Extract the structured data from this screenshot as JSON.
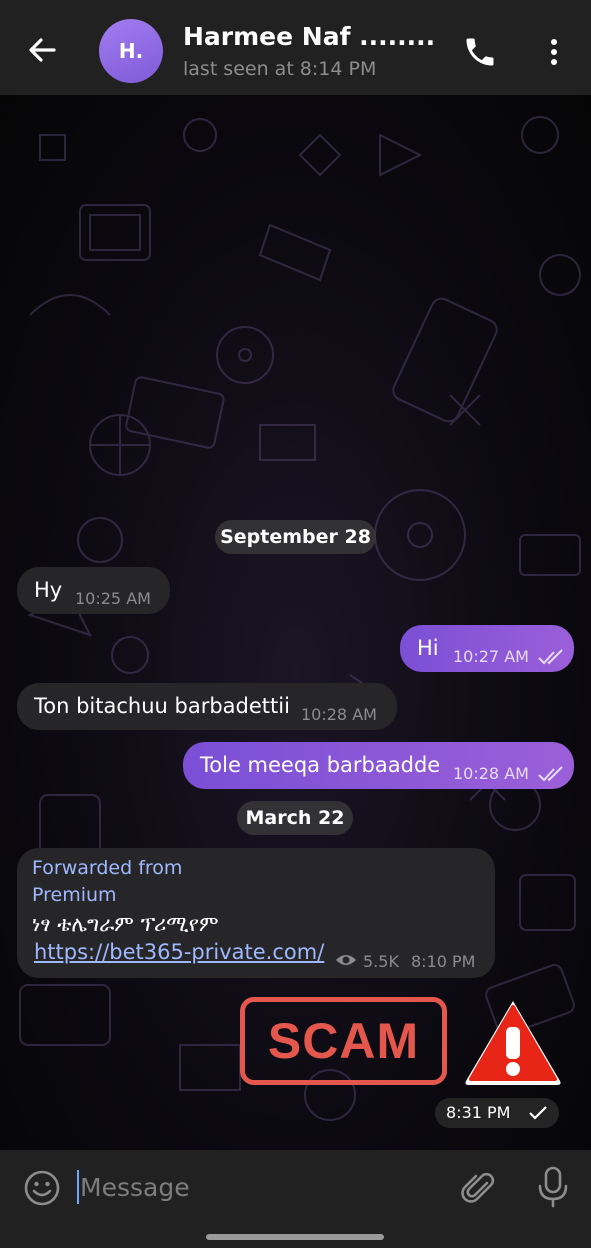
{
  "header": {
    "avatar_initials": "H.",
    "title": "Harmee Naf ........",
    "status": "last seen at 8:14 PM",
    "icons": [
      "back-arrow-icon",
      "phone-icon",
      "more-vert-icon"
    ]
  },
  "chat": {
    "date_1": "September 28",
    "messages": [
      {
        "direction": "in",
        "text": "Hy",
        "time": "10:25 AM"
      },
      {
        "direction": "out",
        "text": "Hi",
        "time": "10:27 AM",
        "read": true
      },
      {
        "direction": "in",
        "text": "Ton bitachuu barbadettii",
        "time": "10:28 AM"
      },
      {
        "direction": "out",
        "text": "Tole meeqa barbaadde",
        "time": "10:28 AM",
        "read": true
      }
    ],
    "date_2": "March 22",
    "forwarded": {
      "label_line1": "Forwarded from",
      "label_line2": "Premium",
      "text": "ነፃ ቴሌግራም ፕሪሚየም",
      "link": "https://bet365-private.com/",
      "views": "5.5K",
      "time": "8:10 PM"
    },
    "sticker": {
      "label": "SCAM",
      "warning_mark": "!",
      "time": "8:31 PM"
    }
  },
  "input_bar": {
    "placeholder": "Message",
    "icons": [
      "emoji-icon",
      "attach-icon",
      "microphone-icon"
    ]
  },
  "colors": {
    "header_bg": "#212121",
    "incoming_bubble": "#262628",
    "outgoing_gradient_start": "#7b4fd6",
    "outgoing_gradient_end": "#9b5fd8",
    "link": "#9fb8ff",
    "scam_red": "#e4574c"
  }
}
